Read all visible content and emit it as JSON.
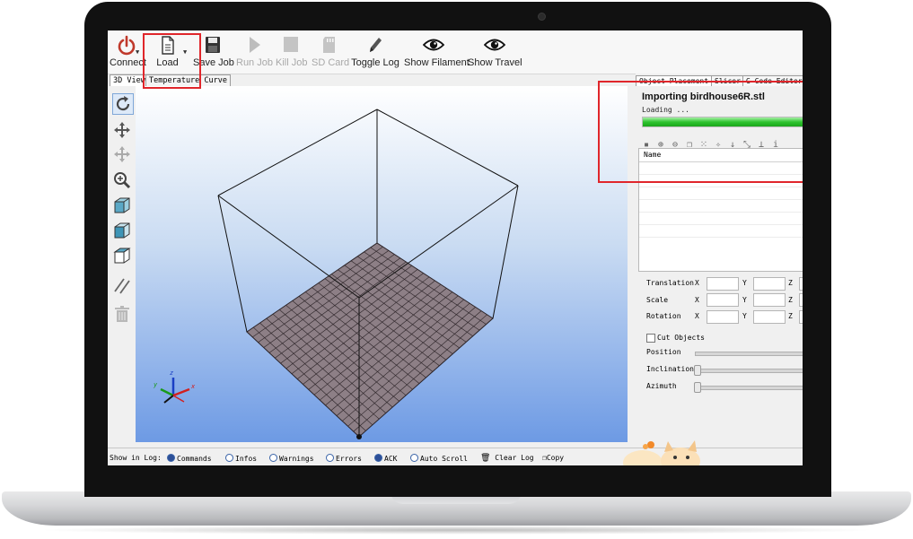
{
  "toolbar": {
    "items": [
      {
        "label": "Connect",
        "icon": "power-icon",
        "enabled": true
      },
      {
        "label": "Load",
        "icon": "document-icon",
        "enabled": true
      },
      {
        "label": "Save Job",
        "icon": "floppy-icon",
        "enabled": true
      },
      {
        "label": "Run Job",
        "icon": "play-icon",
        "enabled": false
      },
      {
        "label": "Kill Job",
        "icon": "stop-icon",
        "enabled": false
      },
      {
        "label": "SD Card",
        "icon": "sd-card-icon",
        "enabled": false
      },
      {
        "label": "Toggle Log",
        "icon": "pencil-icon",
        "enabled": true
      },
      {
        "label": "Show Filament",
        "icon": "eye-icon",
        "enabled": true
      },
      {
        "label": "Show Travel",
        "icon": "eye-icon",
        "enabled": true
      }
    ]
  },
  "view_tabs": [
    "3D View",
    "Temperature Curve"
  ],
  "left_tools": [
    "rotate-icon",
    "move-icon",
    "move-object-icon",
    "zoom-icon",
    "iso-view-icon",
    "front-view-icon",
    "top-view-icon",
    "parallel-lines-icon",
    "trash-icon"
  ],
  "right_panel": {
    "tabs": [
      "Object Placement",
      "Slicer",
      "G-Code Editor"
    ],
    "import_title": "Importing birdhouse6R.stl",
    "loading_text": "Loading ...",
    "progress_percent": 100,
    "object_icons": [
      "save-icon",
      "add-icon",
      "remove-icon",
      "copy-icon",
      "grid-icon",
      "center-icon",
      "drop-icon",
      "scale-icon",
      "land-icon",
      "info-icon"
    ],
    "list_header": "Name",
    "properties": [
      {
        "label": "Translation",
        "axes": [
          "X",
          "Y",
          "Z"
        ]
      },
      {
        "label": "Scale",
        "axes": [
          "X",
          "Y",
          "Z"
        ]
      },
      {
        "label": "Rotation",
        "axes": [
          "X",
          "Y",
          "Z"
        ]
      }
    ],
    "cut_objects_label": "Cut Objects",
    "sliders": [
      {
        "label": "Position"
      },
      {
        "label": "Inclination"
      },
      {
        "label": "Azimuth"
      }
    ]
  },
  "log_bar": {
    "show_in_log_label": "Show in Log:",
    "options": [
      {
        "label": "Commands",
        "checked": true
      },
      {
        "label": "Infos",
        "checked": false
      },
      {
        "label": "Warnings",
        "checked": false
      },
      {
        "label": "Errors",
        "checked": false
      },
      {
        "label": "ACK",
        "checked": true
      },
      {
        "label": "Auto Scroll",
        "checked": false
      }
    ],
    "clear_log_label": "Clear Log",
    "copy_label": "Copy"
  },
  "colors": {
    "highlight": "#e0262b",
    "progress": "#2fc42f",
    "bed": "#8d7f86",
    "power": "#c0392b"
  }
}
